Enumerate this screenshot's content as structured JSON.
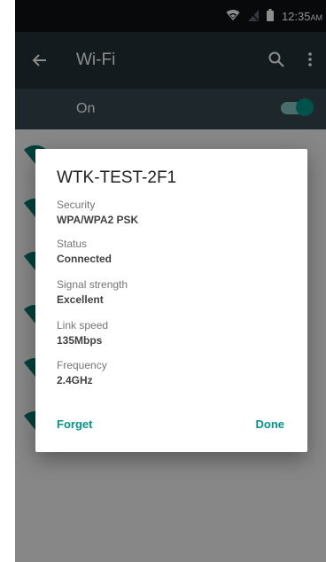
{
  "status_bar": {
    "time": "12:35",
    "ampm": "AM",
    "icons": [
      "wifi-icon",
      "no-signal-icon",
      "battery-icon"
    ]
  },
  "app_bar": {
    "title": "Wi-Fi",
    "icons": [
      "back-arrow-icon",
      "search-icon",
      "more-vert-icon"
    ]
  },
  "wifi_switch": {
    "label": "On",
    "checked": true
  },
  "networks": {
    "visible_rows": 6,
    "icon": "wifi-signal-icon"
  },
  "dialog": {
    "title": "WTK-TEST-2F1",
    "details": [
      {
        "label": "Security",
        "value": "WPA/WPA2 PSK"
      },
      {
        "label": "Status",
        "value": "Connected"
      },
      {
        "label": "Signal strength",
        "value": "Excellent"
      },
      {
        "label": "Link speed",
        "value": "135Mbps"
      },
      {
        "label": "Frequency",
        "value": "2.4GHz"
      }
    ],
    "forget_label": "Forget",
    "done_label": "Done"
  },
  "colors": {
    "accent": "#009688",
    "app_bar": "#263238",
    "switch_bar": "#37474f",
    "status_bar": "#101214"
  }
}
